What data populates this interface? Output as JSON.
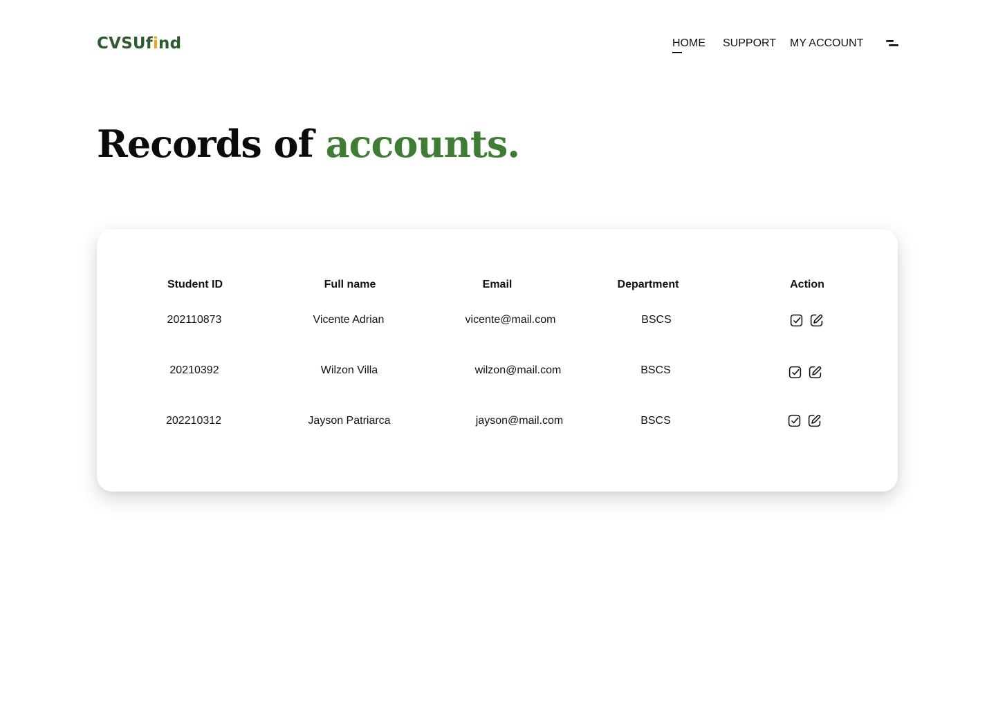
{
  "brand": {
    "logo_part1": "CVSUf",
    "logo_accent": "i",
    "logo_part2": "nd",
    "primary_color": "#2e5a2c",
    "accent_color": "#e6a817"
  },
  "nav": {
    "items": [
      {
        "label": "HOME",
        "active": true
      },
      {
        "label": "SUPPORT",
        "active": false
      },
      {
        "label": "MY ACCOUNT",
        "active": false
      }
    ],
    "menu_icon": "menu-icon"
  },
  "page": {
    "title_main": "Records of ",
    "title_accent": "accounts.",
    "title_accent_color": "#3f7d35"
  },
  "table": {
    "columns": [
      "Student ID",
      "Full name",
      "Email",
      "Department",
      "Action"
    ],
    "rows": [
      {
        "student_id": "202110873",
        "full_name": "Vicente Adrian",
        "email": "vicente@mail.com",
        "department": "BSCS"
      },
      {
        "student_id": "20210392",
        "full_name": "Wilzon Villa",
        "email": "wilzon@mail.com",
        "department": "BSCS"
      },
      {
        "student_id": "202210312",
        "full_name": "Jayson Patriarca",
        "email": "jayson@mail.com",
        "department": "BSCS"
      }
    ],
    "action_icons": [
      "check-square-icon",
      "edit-icon"
    ]
  }
}
